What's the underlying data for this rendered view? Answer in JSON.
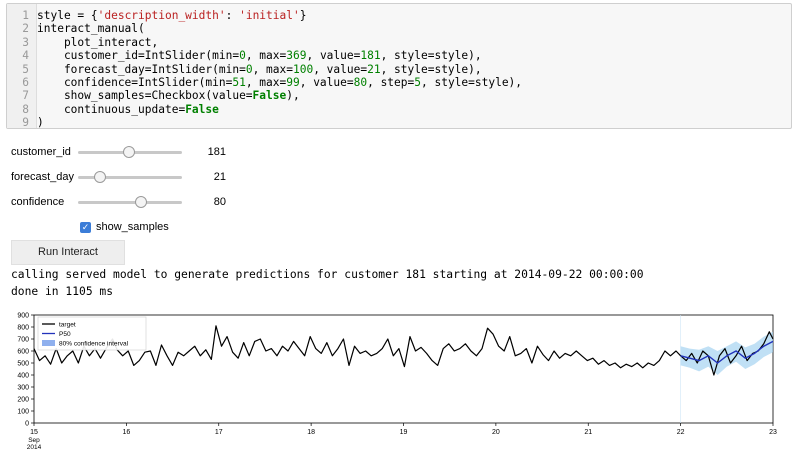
{
  "code_cell": {
    "line_numbers": [
      "1",
      "2",
      "3",
      "4",
      "5",
      "6",
      "7",
      "8",
      "9"
    ],
    "lines": [
      [
        {
          "t": "style = {",
          "c": ""
        },
        {
          "t": "'description_width'",
          "c": "str"
        },
        {
          "t": ": ",
          "c": ""
        },
        {
          "t": "'initial'",
          "c": "str"
        },
        {
          "t": "}",
          "c": ""
        }
      ],
      [
        {
          "t": "interact_manual(",
          "c": ""
        }
      ],
      [
        {
          "t": "    plot_interact,",
          "c": ""
        }
      ],
      [
        {
          "t": "    customer_id=IntSlider(min=",
          "c": ""
        },
        {
          "t": "0",
          "c": "num"
        },
        {
          "t": ", max=",
          "c": ""
        },
        {
          "t": "369",
          "c": "num"
        },
        {
          "t": ", value=",
          "c": ""
        },
        {
          "t": "181",
          "c": "num"
        },
        {
          "t": ", style=style),",
          "c": ""
        }
      ],
      [
        {
          "t": "    forecast_day=IntSlider(min=",
          "c": ""
        },
        {
          "t": "0",
          "c": "num"
        },
        {
          "t": ", max=",
          "c": ""
        },
        {
          "t": "100",
          "c": "num"
        },
        {
          "t": ", value=",
          "c": ""
        },
        {
          "t": "21",
          "c": "num"
        },
        {
          "t": ", style=style),",
          "c": ""
        }
      ],
      [
        {
          "t": "    confidence=IntSlider(min=",
          "c": ""
        },
        {
          "t": "51",
          "c": "num"
        },
        {
          "t": ", max=",
          "c": ""
        },
        {
          "t": "99",
          "c": "num"
        },
        {
          "t": ", value=",
          "c": ""
        },
        {
          "t": "80",
          "c": "num"
        },
        {
          "t": ", step=",
          "c": ""
        },
        {
          "t": "5",
          "c": "num"
        },
        {
          "t": ", style=style),",
          "c": ""
        }
      ],
      [
        {
          "t": "    show_samples=Checkbox(value=",
          "c": ""
        },
        {
          "t": "False",
          "c": "kw"
        },
        {
          "t": "),",
          "c": ""
        }
      ],
      [
        {
          "t": "    continuous_update=",
          "c": ""
        },
        {
          "t": "False",
          "c": "kw"
        }
      ],
      [
        {
          "t": ")",
          "c": ""
        }
      ]
    ]
  },
  "widgets": {
    "sliders": [
      {
        "label": "customer_id",
        "value": "181",
        "min": 0,
        "max": 369,
        "current": 181
      },
      {
        "label": "forecast_day",
        "value": "21",
        "min": 0,
        "max": 100,
        "current": 21
      },
      {
        "label": "confidence",
        "value": "80",
        "min": 51,
        "max": 99,
        "current": 80
      }
    ],
    "checkbox": {
      "label": "show_samples",
      "checked": true
    },
    "run_button": "Run Interact"
  },
  "output_lines": [
    "calling served model to generate predictions for customer 181 starting at 2014-09-22 00:00:00",
    "done in 1105 ms"
  ],
  "chart_data": {
    "type": "line",
    "x_range": [
      15,
      23
    ],
    "ylim": [
      0,
      900
    ],
    "y_ticks": [
      "0",
      "100",
      "200",
      "300",
      "400",
      "500",
      "600",
      "700",
      "800",
      "900"
    ],
    "x_ticks": [
      "15",
      "16",
      "17",
      "18",
      "19",
      "20",
      "21",
      "22",
      "23"
    ],
    "x_sublabels": [
      "Sep",
      "2014"
    ],
    "legend": [
      "target",
      "P50",
      "80% confidence interval"
    ],
    "legend_position": "top-left",
    "colors": {
      "target": "#000000",
      "p50": "#2233bb",
      "interval": "#8fb0ee",
      "samples": "#9ecff0"
    },
    "forecast_start": 22,
    "target": [
      [
        15.0,
        620
      ],
      [
        15.06,
        520
      ],
      [
        15.12,
        560
      ],
      [
        15.18,
        490
      ],
      [
        15.24,
        620
      ],
      [
        15.3,
        500
      ],
      [
        15.36,
        560
      ],
      [
        15.42,
        600
      ],
      [
        15.48,
        500
      ],
      [
        15.54,
        640
      ],
      [
        15.6,
        560
      ],
      [
        15.66,
        620
      ],
      [
        15.72,
        540
      ],
      [
        15.78,
        620
      ],
      [
        15.85,
        700
      ],
      [
        15.9,
        610
      ],
      [
        15.96,
        560
      ],
      [
        16.02,
        600
      ],
      [
        16.08,
        480
      ],
      [
        16.14,
        520
      ],
      [
        16.2,
        590
      ],
      [
        16.26,
        600
      ],
      [
        16.32,
        480
      ],
      [
        16.38,
        650
      ],
      [
        16.44,
        560
      ],
      [
        16.5,
        480
      ],
      [
        16.56,
        590
      ],
      [
        16.62,
        560
      ],
      [
        16.68,
        600
      ],
      [
        16.74,
        640
      ],
      [
        16.8,
        560
      ],
      [
        16.86,
        610
      ],
      [
        16.92,
        530
      ],
      [
        16.97,
        810
      ],
      [
        17.03,
        640
      ],
      [
        17.09,
        720
      ],
      [
        17.15,
        590
      ],
      [
        17.21,
        540
      ],
      [
        17.27,
        670
      ],
      [
        17.33,
        560
      ],
      [
        17.39,
        680
      ],
      [
        17.45,
        700
      ],
      [
        17.51,
        600
      ],
      [
        17.57,
        620
      ],
      [
        17.63,
        560
      ],
      [
        17.69,
        640
      ],
      [
        17.75,
        600
      ],
      [
        17.81,
        680
      ],
      [
        17.87,
        620
      ],
      [
        17.93,
        560
      ],
      [
        17.99,
        720
      ],
      [
        18.05,
        620
      ],
      [
        18.11,
        580
      ],
      [
        18.17,
        670
      ],
      [
        18.23,
        560
      ],
      [
        18.29,
        620
      ],
      [
        18.35,
        700
      ],
      [
        18.41,
        480
      ],
      [
        18.47,
        640
      ],
      [
        18.53,
        580
      ],
      [
        18.59,
        600
      ],
      [
        18.65,
        560
      ],
      [
        18.71,
        580
      ],
      [
        18.77,
        620
      ],
      [
        18.83,
        700
      ],
      [
        18.89,
        560
      ],
      [
        18.95,
        620
      ],
      [
        19.01,
        470
      ],
      [
        19.07,
        720
      ],
      [
        19.13,
        600
      ],
      [
        19.19,
        630
      ],
      [
        19.25,
        580
      ],
      [
        19.31,
        520
      ],
      [
        19.37,
        480
      ],
      [
        19.43,
        620
      ],
      [
        19.49,
        660
      ],
      [
        19.55,
        600
      ],
      [
        19.61,
        620
      ],
      [
        19.67,
        660
      ],
      [
        19.73,
        600
      ],
      [
        19.79,
        560
      ],
      [
        19.85,
        620
      ],
      [
        19.91,
        790
      ],
      [
        19.97,
        740
      ],
      [
        20.03,
        640
      ],
      [
        20.09,
        600
      ],
      [
        20.15,
        720
      ],
      [
        20.21,
        560
      ],
      [
        20.27,
        580
      ],
      [
        20.33,
        620
      ],
      [
        20.39,
        500
      ],
      [
        20.45,
        640
      ],
      [
        20.51,
        570
      ],
      [
        20.57,
        520
      ],
      [
        20.63,
        600
      ],
      [
        20.69,
        540
      ],
      [
        20.75,
        580
      ],
      [
        20.81,
        560
      ],
      [
        20.87,
        600
      ],
      [
        20.93,
        560
      ],
      [
        20.99,
        520
      ],
      [
        21.05,
        540
      ],
      [
        21.11,
        490
      ],
      [
        21.17,
        520
      ],
      [
        21.23,
        480
      ],
      [
        21.29,
        500
      ],
      [
        21.35,
        460
      ],
      [
        21.41,
        490
      ],
      [
        21.47,
        470
      ],
      [
        21.53,
        500
      ],
      [
        21.59,
        460
      ],
      [
        21.65,
        500
      ],
      [
        21.71,
        480
      ],
      [
        21.77,
        520
      ],
      [
        21.83,
        600
      ],
      [
        21.89,
        560
      ],
      [
        21.95,
        600
      ],
      [
        22.0,
        560
      ],
      [
        22.06,
        520
      ],
      [
        22.12,
        580
      ],
      [
        22.18,
        500
      ],
      [
        22.24,
        600
      ],
      [
        22.3,
        560
      ],
      [
        22.36,
        400
      ],
      [
        22.42,
        560
      ],
      [
        22.48,
        620
      ],
      [
        22.54,
        500
      ],
      [
        22.6,
        560
      ],
      [
        22.66,
        640
      ],
      [
        22.72,
        520
      ],
      [
        22.78,
        580
      ],
      [
        22.84,
        600
      ],
      [
        22.9,
        660
      ],
      [
        22.96,
        760
      ],
      [
        23.0,
        700
      ]
    ],
    "p50": [
      [
        22.0,
        560
      ],
      [
        22.1,
        540
      ],
      [
        22.2,
        520
      ],
      [
        22.3,
        560
      ],
      [
        22.4,
        500
      ],
      [
        22.5,
        560
      ],
      [
        22.6,
        600
      ],
      [
        22.7,
        540
      ],
      [
        22.8,
        580
      ],
      [
        22.9,
        640
      ],
      [
        23.0,
        680
      ]
    ],
    "interval_upper": [
      [
        22.0,
        640
      ],
      [
        22.1,
        620
      ],
      [
        22.2,
        610
      ],
      [
        22.3,
        640
      ],
      [
        22.4,
        600
      ],
      [
        22.5,
        640
      ],
      [
        22.6,
        680
      ],
      [
        22.7,
        630
      ],
      [
        22.8,
        660
      ],
      [
        22.9,
        720
      ],
      [
        23.0,
        760
      ]
    ],
    "interval_lower": [
      [
        22.0,
        480
      ],
      [
        22.1,
        460
      ],
      [
        22.2,
        430
      ],
      [
        22.3,
        470
      ],
      [
        22.4,
        400
      ],
      [
        22.5,
        470
      ],
      [
        22.6,
        510
      ],
      [
        22.7,
        450
      ],
      [
        22.8,
        490
      ],
      [
        22.9,
        550
      ],
      [
        23.0,
        590
      ]
    ]
  }
}
